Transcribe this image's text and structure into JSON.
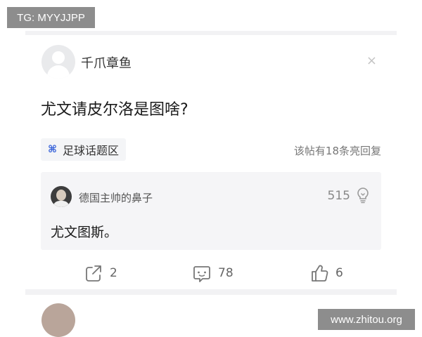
{
  "watermarks": {
    "top_left": "TG: MYYJJPP",
    "bottom_right": "www.zhitou.org"
  },
  "post": {
    "author": "千爪章鱼",
    "avatar_icon": "default-user-avatar-icon",
    "close_icon": "close-icon",
    "close_label": "×",
    "question": "尤文请皮尔洛是图啥?",
    "topic": {
      "icon": "topic-hash-icon",
      "icon_glyph": "⌘",
      "label": "足球话题区",
      "accent": "#2e5bd8"
    },
    "reply_count_text": "该帖有18条亮回复",
    "top_reply": {
      "author": "德国主帅的鼻子",
      "likes": "515",
      "like_icon": "lightbulb-icon",
      "text": "尤文图斯。"
    },
    "actions": {
      "share": {
        "icon": "share-icon",
        "count": "2"
      },
      "comment": {
        "icon": "comment-icon",
        "count": "78"
      },
      "like": {
        "icon": "thumbs-up-icon",
        "count": "6"
      }
    }
  }
}
